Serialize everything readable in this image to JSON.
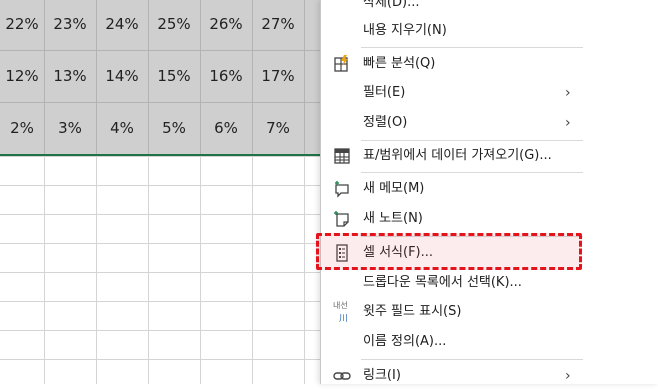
{
  "grid": {
    "rows": [
      [
        "22%",
        "23%",
        "24%",
        "25%",
        "26%",
        "27%"
      ],
      [
        "12%",
        "13%",
        "14%",
        "15%",
        "16%",
        "17%"
      ],
      [
        "2%",
        "3%",
        "4%",
        "5%",
        "6%",
        "7%"
      ]
    ]
  },
  "menu": {
    "items": [
      {
        "label": "삭제(D)...",
        "icon": "none"
      },
      {
        "label": "내용 지우기(N)",
        "icon": "none"
      },
      {
        "label": "빠른 분석(Q)",
        "icon": "quick-analysis-icon"
      },
      {
        "label": "필터(E)",
        "icon": "none",
        "submenu": true
      },
      {
        "label": "정렬(O)",
        "icon": "none",
        "submenu": true
      },
      {
        "label": "표/범위에서 데이터 가져오기(G)...",
        "icon": "table-icon"
      },
      {
        "label": "새 메모(M)",
        "icon": "new-comment-icon"
      },
      {
        "label": "새 노트(N)",
        "icon": "new-note-icon"
      },
      {
        "label": "셀 서식(F)...",
        "icon": "format-cells-icon",
        "highlighted": true
      },
      {
        "label": "드롭다운 목록에서 선택(K)...",
        "icon": "none"
      },
      {
        "label": "윗주 필드 표시(S)",
        "icon": "phonetic-icon",
        "icon_text": "내선",
        "icon_subtext": "川"
      },
      {
        "label": "이름 정의(A)...",
        "icon": "none"
      },
      {
        "label": "링크(I)",
        "icon": "link-icon",
        "submenu": true
      }
    ],
    "submenu_glyph": "›"
  },
  "colors": {
    "selection": "#cfcfcf",
    "selection_border": "#217346",
    "highlight_border": "#e3141c"
  }
}
